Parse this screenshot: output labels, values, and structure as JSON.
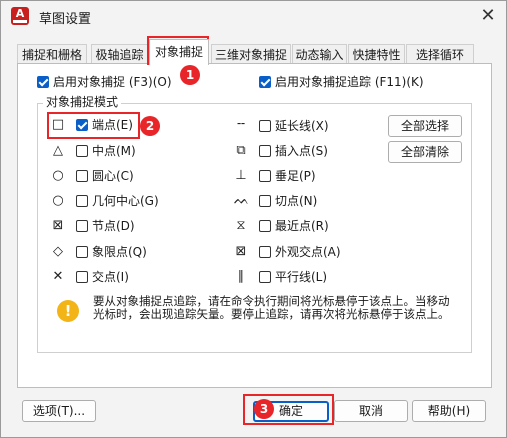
{
  "window": {
    "title": "草图设置",
    "close_glyph": "✕"
  },
  "tabs": [
    {
      "label": "捕捉和栅格",
      "active": false
    },
    {
      "label": "极轴追踪",
      "active": false
    },
    {
      "label": "对象捕捉",
      "active": true
    },
    {
      "label": "三维对象捕捉",
      "active": false
    },
    {
      "label": "动态输入",
      "active": false
    },
    {
      "label": "快捷特性",
      "active": false
    },
    {
      "label": "选择循环",
      "active": false
    }
  ],
  "toggles": {
    "enable_osnap": {
      "label": "启用对象捕捉 (F3)(O)",
      "checked": true
    },
    "enable_tracking": {
      "label": "启用对象捕捉追踪 (F11)(K)",
      "checked": true
    }
  },
  "group_title": "对象捕捉模式",
  "snap_modes_left": [
    {
      "icon": "endpoint-square-icon",
      "glyph": "□",
      "label": "端点(E)",
      "checked": true
    },
    {
      "icon": "midpoint-triangle-icon",
      "glyph": "△",
      "label": "中点(M)",
      "checked": false
    },
    {
      "icon": "center-circle-icon",
      "glyph": "○",
      "label": "圆心(C)",
      "checked": false
    },
    {
      "icon": "geometric-center-icon",
      "glyph": "○",
      "label": "几何中心(G)",
      "checked": false
    },
    {
      "icon": "node-icon",
      "glyph": "⊠",
      "label": "节点(D)",
      "checked": false
    },
    {
      "icon": "quadrant-diamond-icon",
      "glyph": "◇",
      "label": "象限点(Q)",
      "checked": false
    },
    {
      "icon": "intersection-x-icon",
      "glyph": "✕",
      "label": "交点(I)",
      "checked": false
    }
  ],
  "snap_modes_right": [
    {
      "icon": "extension-icon",
      "glyph": "╌",
      "label": "延长线(X)",
      "checked": false
    },
    {
      "icon": "insertion-icon",
      "glyph": "⧉",
      "label": "插入点(S)",
      "checked": false
    },
    {
      "icon": "perpendicular-icon",
      "glyph": "⊥",
      "label": "垂足(P)",
      "checked": false
    },
    {
      "icon": "tangent-icon",
      "glyph": "ᨓ",
      "label": "切点(N)",
      "checked": false
    },
    {
      "icon": "nearest-icon",
      "glyph": "⧖",
      "label": "最近点(R)",
      "checked": false
    },
    {
      "icon": "apparent-intersection-icon",
      "glyph": "⊠",
      "label": "外观交点(A)",
      "checked": false
    },
    {
      "icon": "parallel-icon",
      "glyph": "∥",
      "label": "平行线(L)",
      "checked": false
    }
  ],
  "buttons": {
    "select_all": "全部选择",
    "clear_all": "全部清除",
    "options": "选项(T)...",
    "ok": "确定",
    "cancel": "取消",
    "help": "帮助(H)"
  },
  "info_text": "要从对象捕捉点追踪，请在命令执行期间将光标悬停于该点上。当移动光标时，会出现追踪矢量。要停止追踪，请再次将光标悬停于该点上。",
  "badges": [
    "1",
    "2",
    "3"
  ],
  "colors": {
    "highlight": "#e8262a",
    "accent": "#0a5ec7",
    "info": "#f2b417"
  }
}
